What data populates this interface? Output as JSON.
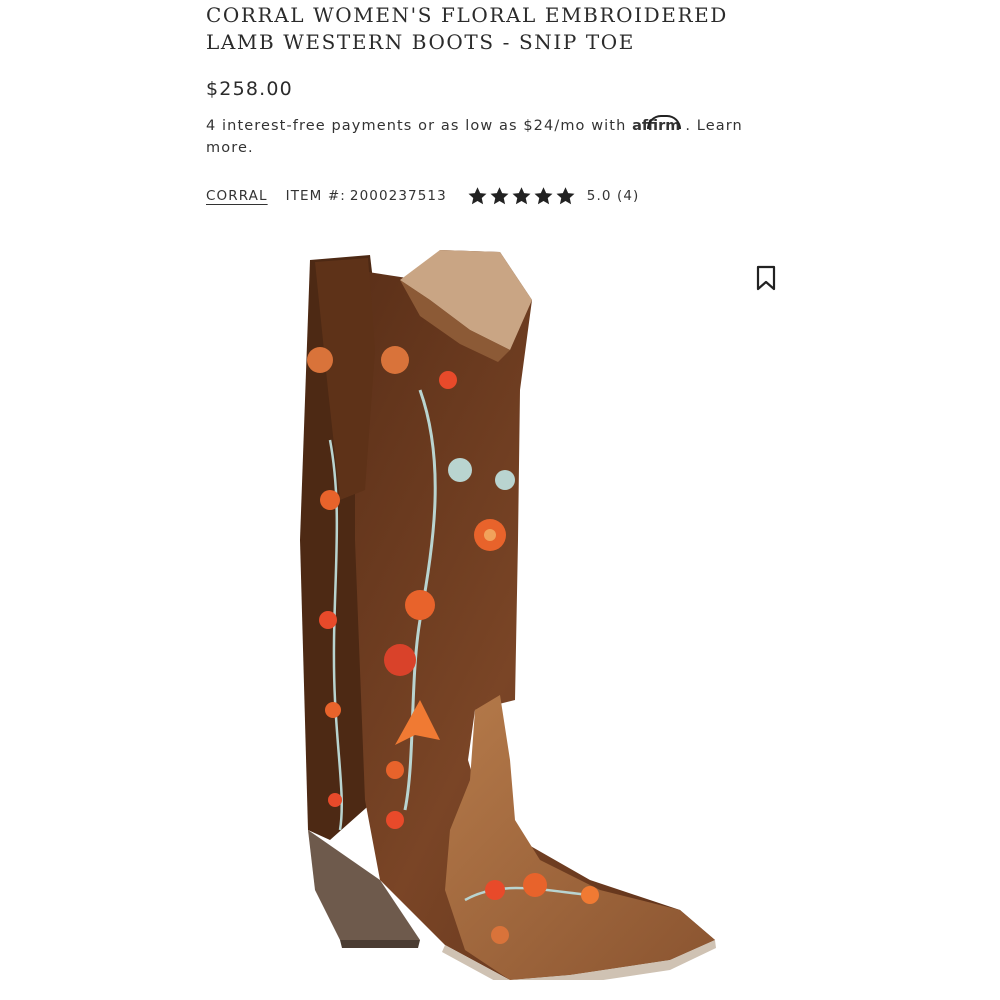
{
  "product": {
    "title_line1": "CORRAL WOMEN'S FLORAL EMBROIDERED",
    "title_line2": "LAMB WESTERN BOOTS - SNIP TOE",
    "price": "$258.00",
    "installments_text": "4 interest-free payments or as low as $24/mo with",
    "affirm_logo_text": "affirm",
    "learn_more": ". Learn more.",
    "brand": "CORRAL",
    "item_label": "ITEM #:",
    "item_number": "2000237513",
    "rating_value": 5.0,
    "rating_text": "5.0 (4)"
  },
  "icons": {
    "star": "star-icon",
    "bookmark": "bookmark-icon"
  },
  "colors": {
    "text": "#2b2b2b",
    "star": "#222222",
    "boot_leather": "#6b3b1f",
    "embroidery_orange": "#e8632b"
  }
}
